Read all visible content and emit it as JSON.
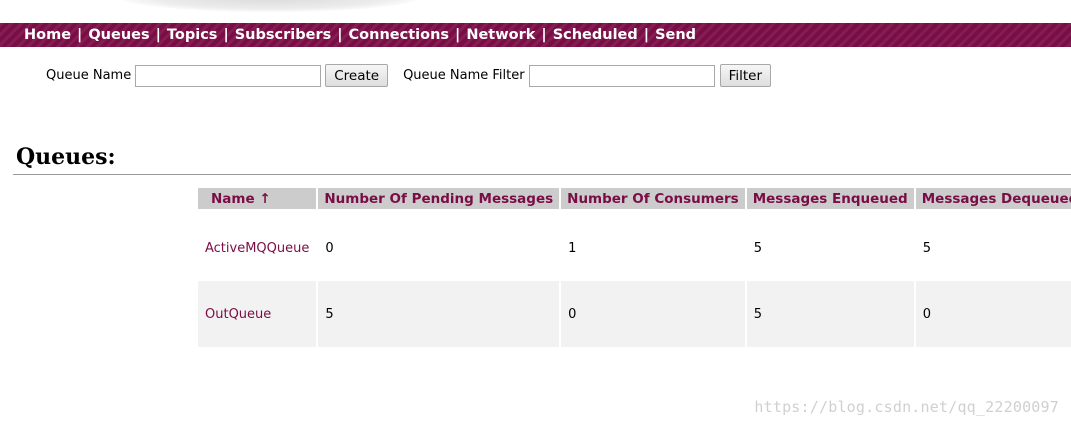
{
  "nav": {
    "items": [
      "Home",
      "Queues",
      "Topics",
      "Subscribers",
      "Connections",
      "Network",
      "Scheduled",
      "Send"
    ],
    "separator": "|"
  },
  "form": {
    "queue_name_label": "Queue Name",
    "queue_name_value": "",
    "create_label": "Create",
    "filter_label": "Queue Name Filter",
    "filter_value": "",
    "filter_button_label": "Filter"
  },
  "heading": "Queues:",
  "table": {
    "columns": [
      "Name ↑",
      "Number Of Pending Messages",
      "Number Of Consumers",
      "Messages Enqueued",
      "Messages Dequeued"
    ],
    "rows": [
      {
        "name": "ActiveMQQueue",
        "pending": "0",
        "consumers": "1",
        "enqueued": "5",
        "dequeued": "5"
      },
      {
        "name": "OutQueue",
        "pending": "5",
        "consumers": "0",
        "enqueued": "5",
        "dequeued": "0"
      }
    ]
  },
  "watermark": "https://blog.csdn.net/qq_22200097",
  "colors": {
    "brand": "#7a0d45",
    "header_bg": "#cccccc",
    "row_alt": "#f2f2f2"
  }
}
